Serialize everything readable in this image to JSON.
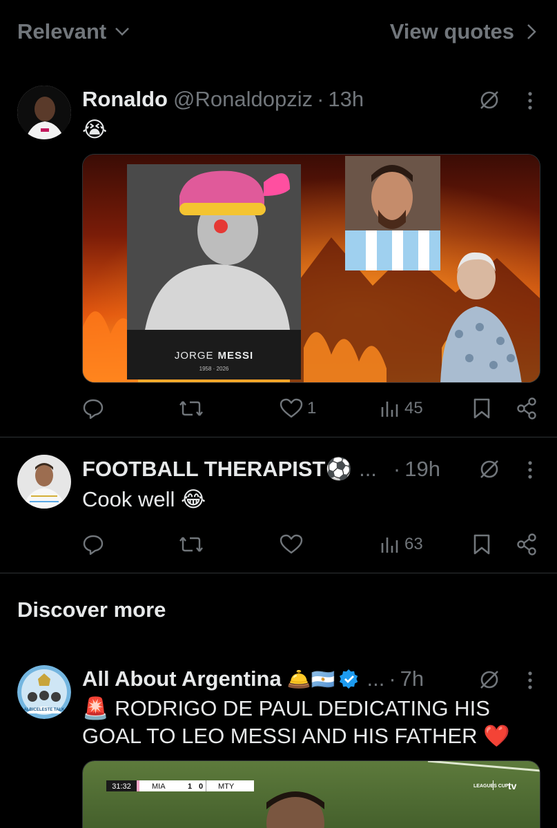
{
  "top": {
    "sort_label": "Relevant",
    "view_quotes_label": "View quotes"
  },
  "posts": [
    {
      "name": "Ronaldo",
      "handle": "@Ronaldopziz",
      "time": "13h",
      "text": "😭",
      "image": {
        "caption_first": "JORGE",
        "caption_last": "MESSI",
        "years": "1958 · 2026"
      },
      "likes": "1",
      "views": "45"
    },
    {
      "name": "FOOTBALL THERAPIST⚽️",
      "ellipsis": "...",
      "time": "19h",
      "text": "Cook well 😂",
      "likes": "",
      "views": "63"
    }
  ],
  "discover_heading": "Discover more",
  "post3": {
    "name": "All About Argentina",
    "emoji": "🛎️🇦🇷",
    "ellipsis": "...",
    "time": "7h",
    "text_line1": "🚨 RODRIGO DE PAUL DEDICATING HIS",
    "text_line2": "GOAL TO LEO MESSI AND HIS FATHER ❤️",
    "scoreboard": {
      "clock": "31:32",
      "home": "MIA",
      "home_score": "1",
      "away_score": "0",
      "away": "MTY",
      "league": "LEAGUES CUP",
      "broadcaster": "tv"
    },
    "avatar_text": "ALBICELESTE TALK"
  },
  "colors": {
    "background": "#000000",
    "primary_text": "#e7e9ea",
    "secondary_text": "#71767b",
    "divider": "#2f3336",
    "verified": "#1d9bf0"
  }
}
